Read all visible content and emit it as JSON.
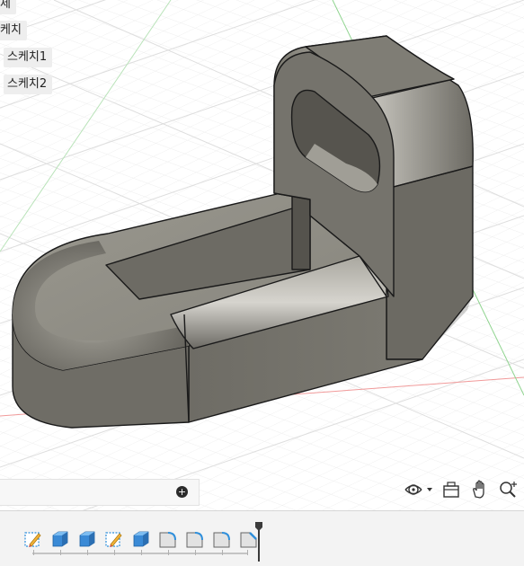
{
  "browser": {
    "items": [
      {
        "label": "제"
      },
      {
        "label": "케치"
      },
      {
        "label": "스케치1"
      },
      {
        "label": "스케치2"
      }
    ]
  },
  "command_bar": {
    "value": "",
    "add_glyph": "+"
  },
  "navigation": {
    "icons": [
      "orbit-icon",
      "dropdown-arrow-icon",
      "look-at-icon",
      "pan-hand-icon",
      "zoom-icon"
    ]
  },
  "timeline": {
    "items": [
      {
        "type": "sketch",
        "icon": "sketch-icon"
      },
      {
        "type": "extrude",
        "icon": "extrude-icon"
      },
      {
        "type": "extrude",
        "icon": "extrude-icon"
      },
      {
        "type": "sketch",
        "icon": "sketch-icon"
      },
      {
        "type": "extrude",
        "icon": "extrude-icon"
      },
      {
        "type": "fillet",
        "icon": "fillet-icon"
      },
      {
        "type": "fillet",
        "icon": "fillet-icon"
      },
      {
        "type": "fillet",
        "icon": "fillet-icon"
      },
      {
        "type": "chamfer",
        "icon": "chamfer-icon"
      }
    ]
  },
  "colors": {
    "grid_minor": "#ececec",
    "grid_major": "#d8d8d8",
    "axis_red": "#f19a9a",
    "axis_green": "#8fd48f",
    "body_light": "#8c8a82",
    "body_mid": "#6f6d66",
    "body_dark": "#57554f",
    "edge": "#1a1a1a",
    "sketch_blue": "#2f8fdb",
    "body_blue": "#3a8ad6"
  }
}
